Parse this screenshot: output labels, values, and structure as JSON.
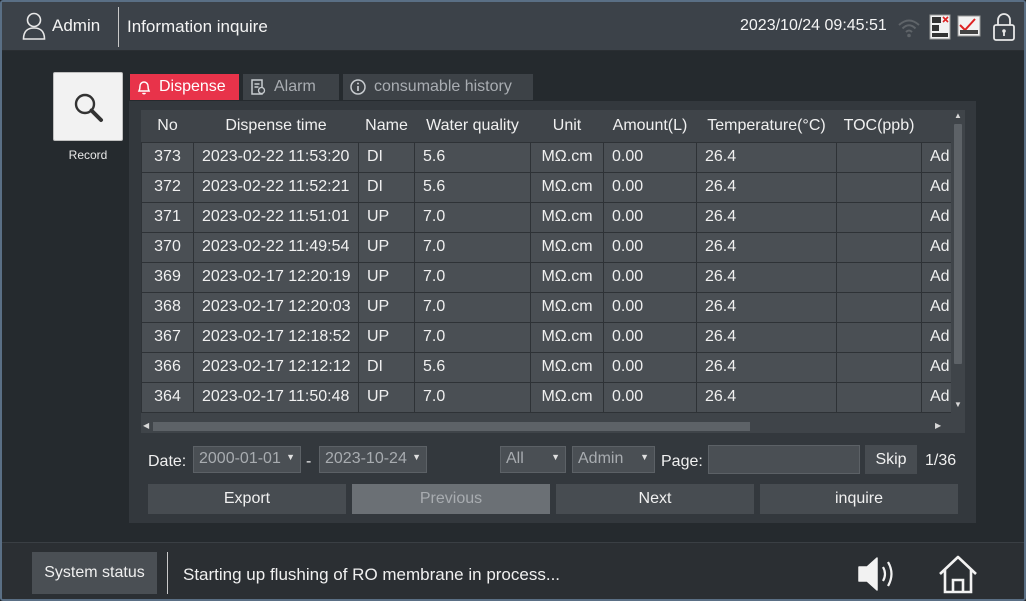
{
  "header": {
    "user": "Admin",
    "title": "Information inquire",
    "datetime": "2023/10/24 09:45:51",
    "icons": [
      "user-icon",
      "wifi-icon",
      "device-icon",
      "chart-icon",
      "lock-icon"
    ]
  },
  "left": {
    "record_label": "Record"
  },
  "tabs": [
    {
      "label": "Dispense",
      "active": true
    },
    {
      "label": "Alarm",
      "active": false
    },
    {
      "label": "consumable history",
      "active": false
    }
  ],
  "table": {
    "columns": [
      "No",
      "Dispense time",
      "Name",
      "Water quality",
      "Unit",
      "Amount(L)",
      "Temperature(°C)",
      "TOC(ppb)",
      ""
    ],
    "rows": [
      [
        "373",
        "2023-02-22 11:53:20",
        "DI",
        "5.6",
        "MΩ.cm",
        "0.00",
        "26.4",
        "",
        "Ad"
      ],
      [
        "372",
        "2023-02-22 11:52:21",
        "DI",
        "5.6",
        "MΩ.cm",
        "0.00",
        "26.4",
        "",
        "Ad"
      ],
      [
        "371",
        "2023-02-22 11:51:01",
        "UP",
        "7.0",
        "MΩ.cm",
        "0.00",
        "26.4",
        "",
        "Ad"
      ],
      [
        "370",
        "2023-02-22 11:49:54",
        "UP",
        "7.0",
        "MΩ.cm",
        "0.00",
        "26.4",
        "",
        "Ad"
      ],
      [
        "369",
        "2023-02-17 12:20:19",
        "UP",
        "7.0",
        "MΩ.cm",
        "0.00",
        "26.4",
        "",
        "Ad"
      ],
      [
        "368",
        "2023-02-17 12:20:03",
        "UP",
        "7.0",
        "MΩ.cm",
        "0.00",
        "26.4",
        "",
        "Ad"
      ],
      [
        "367",
        "2023-02-17 12:18:52",
        "UP",
        "7.0",
        "MΩ.cm",
        "0.00",
        "26.4",
        "",
        "Ad"
      ],
      [
        "366",
        "2023-02-17 12:12:12",
        "DI",
        "5.6",
        "MΩ.cm",
        "0.00",
        "26.4",
        "",
        "Ad"
      ],
      [
        "364",
        "2023-02-17 11:50:48",
        "UP",
        "7.0",
        "MΩ.cm",
        "0.00",
        "26.4",
        "",
        "Ad"
      ]
    ]
  },
  "filters": {
    "date_label": "Date:",
    "date_from": "2000-01-01",
    "date_sep": "-",
    "date_to": "2023-10-24",
    "type": "All",
    "user": "Admin",
    "page_label": "Page:",
    "page_value": "",
    "skip_label": "Skip",
    "page_info": "1/36"
  },
  "actions": {
    "export": "Export",
    "previous": "Previous",
    "next": "Next",
    "inquire": "inquire"
  },
  "footer": {
    "system_status": "System status",
    "message": "Starting up flushing of RO membrane in process..."
  },
  "colors": {
    "accent": "#e8334a",
    "background": "#252a2e",
    "cell": "#4a4f54"
  }
}
